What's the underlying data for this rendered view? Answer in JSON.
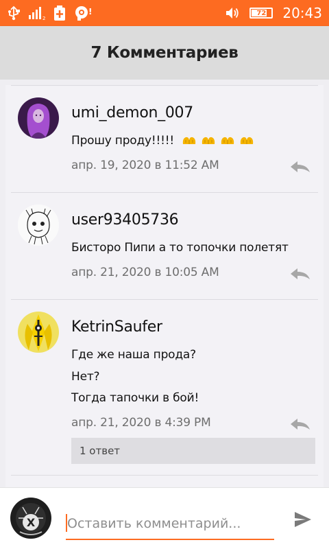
{
  "status_bar": {
    "time": "20:43",
    "battery_level": "72",
    "battery_fraction": 0.72,
    "icons": [
      "usb-icon",
      "signal-icon",
      "battery-saver-icon",
      "hotspot-icon",
      "volume-icon",
      "battery-icon"
    ]
  },
  "header": {
    "title": "7 Комментариев"
  },
  "colors": {
    "accent": "#fd6b21",
    "header_bg": "#dcdcdc",
    "date_text": "#6e6e6e"
  },
  "comments": [
    {
      "username": "umi_demon_007",
      "lines": [
        "Прошу проду!!!!!"
      ],
      "emoji": [
        "pleading-hands-emoji",
        "pleading-hands-emoji",
        "pleading-hands-emoji",
        "pleading-hands-emoji"
      ],
      "date": "апр. 19, 2020 в 11:52 AM"
    },
    {
      "username": "user93405736",
      "lines": [
        "Бисторо Пипи а то топочки полетят"
      ],
      "date": "апр. 21, 2020 в 10:05 AM"
    },
    {
      "username": "KetrinSaufer",
      "lines": [
        "Где же наша прода?",
        "Нет?",
        "Тогда тапочки в бой!"
      ],
      "date": "апр. 21, 2020 в 4:39 PM",
      "replies_label": "1 ответ"
    }
  ],
  "composer": {
    "placeholder": "Оставить комментарий..."
  }
}
